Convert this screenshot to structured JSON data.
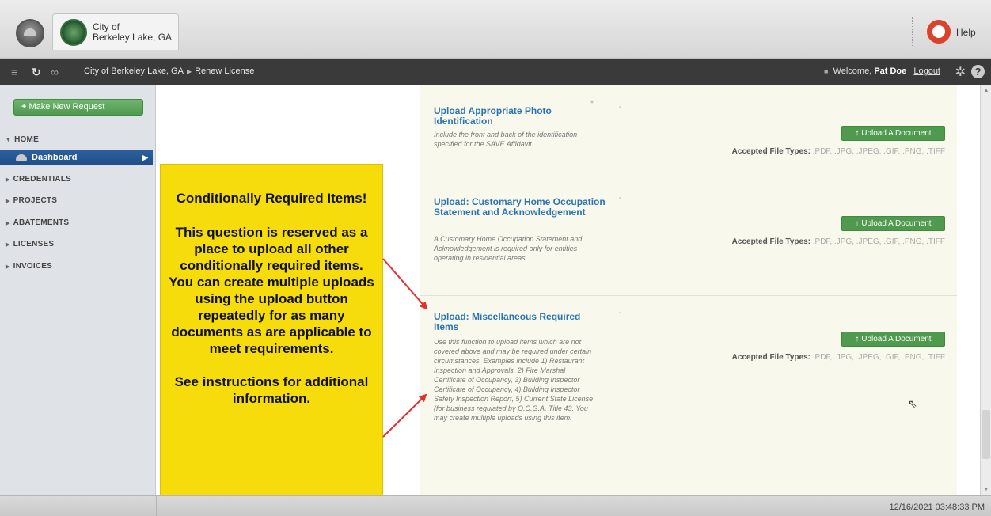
{
  "header": {
    "app_logo_icon": "app-logo-icon",
    "org_name_line1": "City of",
    "org_name_line2": "Berkeley Lake, GA",
    "help_label": "Help",
    "help_icon": "lifebuoy-icon"
  },
  "navbar": {
    "breadcrumb_root": "City of Berkeley Lake, GA",
    "breadcrumb_current": "Renew License",
    "welcome_prefix": "Welcome,",
    "user_name": "Pat Doe",
    "logout_label": "Logout"
  },
  "sidebar": {
    "new_request_label": "Make New Request",
    "sections": {
      "home": "HOME",
      "dashboard": "Dashboard",
      "credentials": "CREDENTIALS",
      "projects": "PROJECTS",
      "abatements": "ABATEMENTS",
      "licenses": "LICENSES",
      "invoices": "INVOICES"
    }
  },
  "items": [
    {
      "title": "Upload Appropriate Photo Identification",
      "description": "Include the front and back of the identification specified for the SAVE Affidavit.",
      "required_marker": "*",
      "status": "-",
      "upload_label": "Upload A Document",
      "types_label": "Accepted File Types:",
      "types_value": ".PDF, .JPG, .JPEG, .GIF, .PNG, .TIFF"
    },
    {
      "title": "Upload: Customary Home Occupation Statement and Acknowledgement",
      "description": "A Customary Home Occupation Statement and Acknowledgement is required only for entities operating in residential areas.",
      "status": "-",
      "upload_label": "Upload A Document",
      "types_label": "Accepted File Types:",
      "types_value": ".PDF, .JPG, .JPEG, .GIF, .PNG, .TIFF"
    },
    {
      "title": "Upload: Miscellaneous Required Items",
      "description": "Use this function to upload items which are not covered above and may be required under certain circumstances. Examples include 1) Restaurant Inspection and Approvals, 2) Fire Marshal Certificate of Occupancy, 3) Building Inspector Certificate of Occupancy, 4) Building Inspector Safety Inspection Report, 5) Current State License (for business regulated by O.C.G.A. Title 43. You may create multiple uploads using this item.",
      "status": "-",
      "upload_label": "Upload A Document",
      "types_label": "Accepted File Types:",
      "types_value": ".PDF, .JPG, .JPEG, .GIF, .PNG, .TIFF"
    }
  ],
  "callout": {
    "heading": "Conditionally Required Items!",
    "body": "This question is reserved as a place to upload all other conditionally required items. You can create multiple uploads using the upload button repeatedly for as many documents as are applicable to meet requirements.",
    "footer": "See instructions for additional information."
  },
  "footer": {
    "timestamp": "12/16/2021 03:48:33 PM"
  },
  "colors": {
    "accent_green": "#4f9a4f",
    "link_blue": "#2a74b4",
    "callout_yellow": "#f5dc0a",
    "nav_dark": "#3a3a3a",
    "arrow_red": "#e03030"
  }
}
